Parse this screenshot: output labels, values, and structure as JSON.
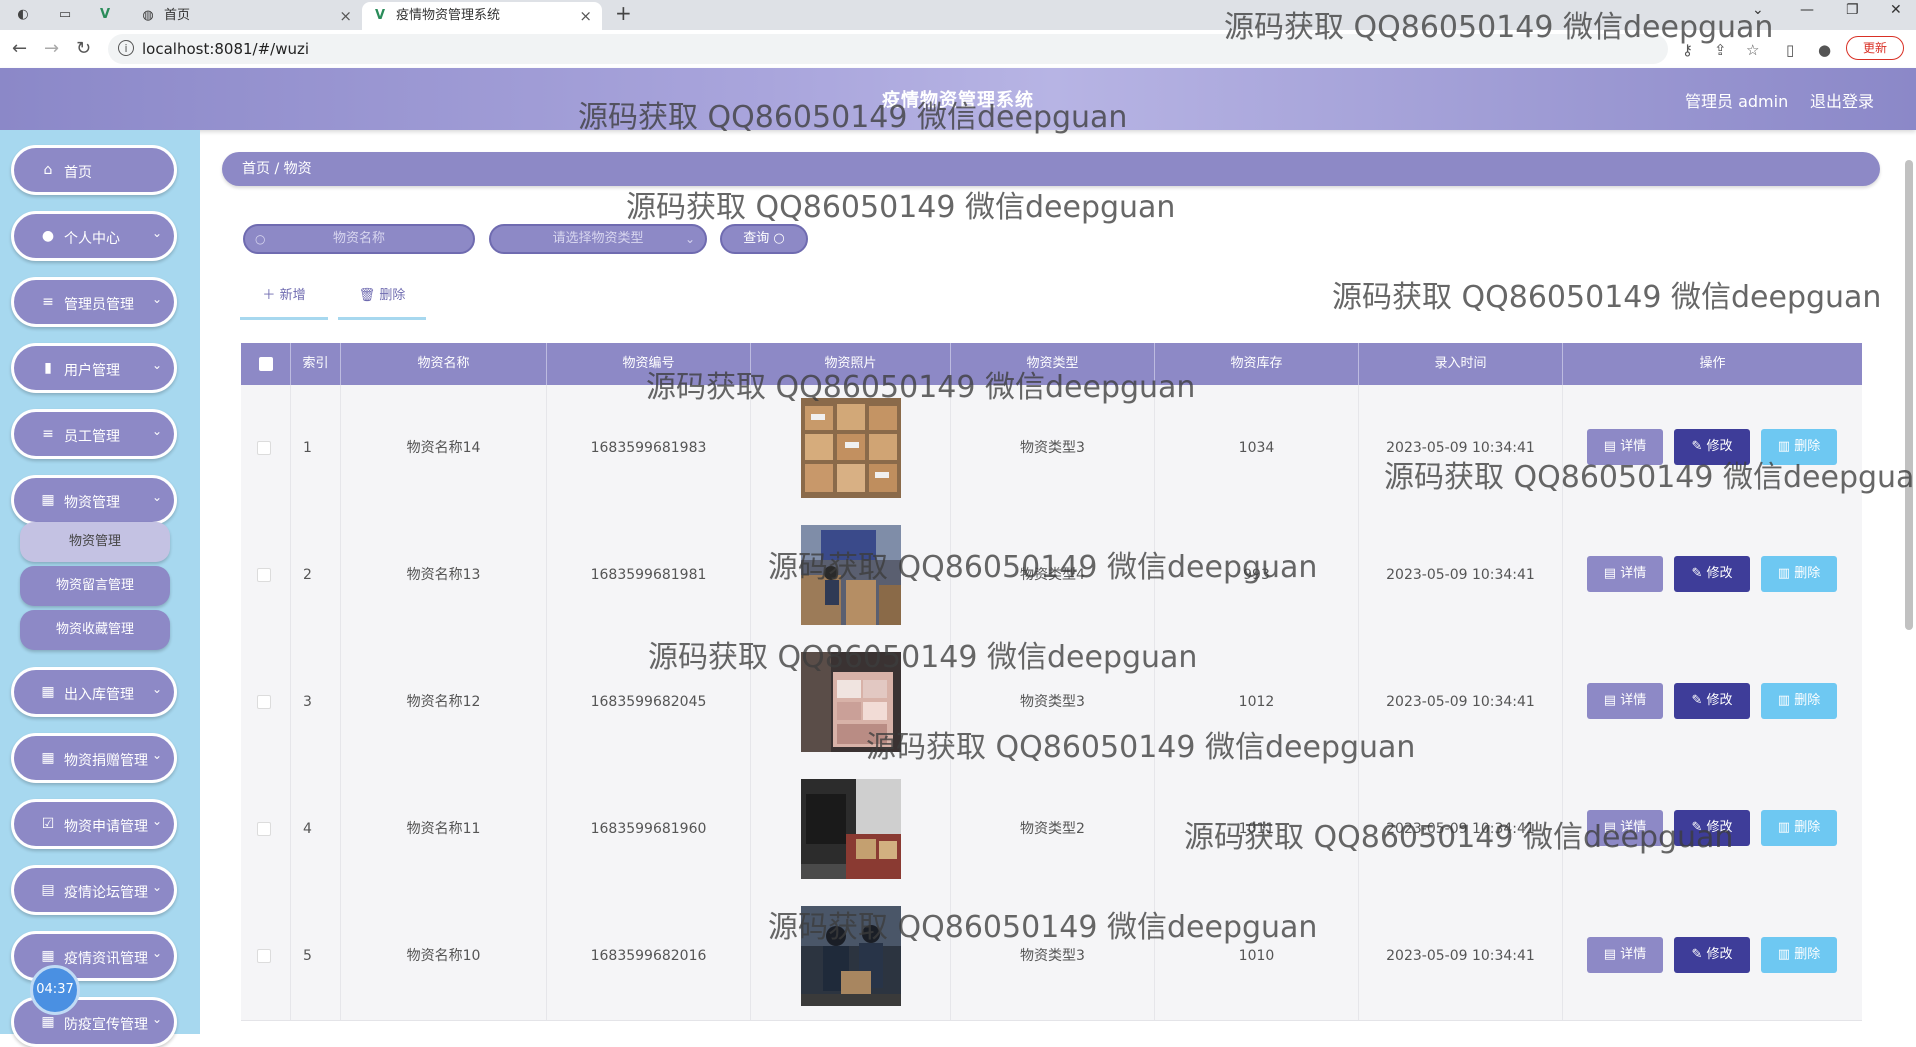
{
  "browser": {
    "tabs": [
      {
        "title": "首页",
        "active": false
      },
      {
        "title": "疫情物资管理系统",
        "active": true
      }
    ],
    "url": "localhost:8081/#/wuzi",
    "update_label": "更新"
  },
  "header": {
    "title": "疫情物资管理系统",
    "user": "管理员 admin",
    "logout": "退出登录"
  },
  "sidebar": {
    "items": [
      {
        "label": "首页",
        "icon": "home-icon"
      },
      {
        "label": "个人中心",
        "icon": "user-icon"
      },
      {
        "label": "管理员管理",
        "icon": "list-icon"
      },
      {
        "label": "用户管理",
        "icon": "bar-chart-icon"
      },
      {
        "label": "员工管理",
        "icon": "list-icon"
      },
      {
        "label": "物资管理",
        "icon": "grid-icon"
      },
      {
        "label": "出入库管理",
        "icon": "grid-icon"
      },
      {
        "label": "物资捐赠管理",
        "icon": "grid-icon"
      },
      {
        "label": "物资申请管理",
        "icon": "check-square-icon"
      },
      {
        "label": "疫情论坛管理",
        "icon": "clipboard-icon"
      },
      {
        "label": "疫情资讯管理",
        "icon": "grid-icon"
      },
      {
        "label": "防疫宣传管理",
        "icon": "grid-icon"
      }
    ],
    "submenu": [
      {
        "label": "物资管理",
        "active": true
      },
      {
        "label": "物资留言管理",
        "active": false
      },
      {
        "label": "物资收藏管理",
        "active": false
      }
    ],
    "timer": "04:37"
  },
  "breadcrumb": "首页  /  物资",
  "search": {
    "name_placeholder": "物资名称",
    "type_placeholder": "请选择物资类型",
    "query_label": "查询"
  },
  "actions": {
    "add_label": "新增",
    "delete_label": "删除"
  },
  "table": {
    "columns": [
      "索引",
      "物资名称",
      "物资编号",
      "物资照片",
      "物资类型",
      "物资库存",
      "录入时间",
      "操作"
    ],
    "rows": [
      {
        "index": "1",
        "name": "物资名称14",
        "code": "1683599681983",
        "type": "物资类型3",
        "stock": "1034",
        "time": "2023-05-09 10:34:41"
      },
      {
        "index": "2",
        "name": "物资名称13",
        "code": "1683599681981",
        "type": "物资类型4",
        "stock": "993",
        "time": "2023-05-09 10:34:41"
      },
      {
        "index": "3",
        "name": "物资名称12",
        "code": "1683599682045",
        "type": "物资类型3",
        "stock": "1012",
        "time": "2023-05-09 10:34:41"
      },
      {
        "index": "4",
        "name": "物资名称11",
        "code": "1683599681960",
        "type": "物资类型2",
        "stock": "1011",
        "time": "2023-05-09 10:34:41"
      },
      {
        "index": "5",
        "name": "物资名称10",
        "code": "1683599682016",
        "type": "物资类型3",
        "stock": "1010",
        "time": "2023-05-09 10:34:41"
      }
    ],
    "ops": {
      "detail": "详情",
      "edit": "修改",
      "delete": "删除"
    }
  },
  "watermark": "源码获取 QQ86050149 微信deepguan",
  "colors": {
    "primary": "#8d89c6",
    "sidebar_bg": "#a7d8ef",
    "edit_btn": "#3e3d99",
    "delete_btn": "#6ec8f2"
  }
}
